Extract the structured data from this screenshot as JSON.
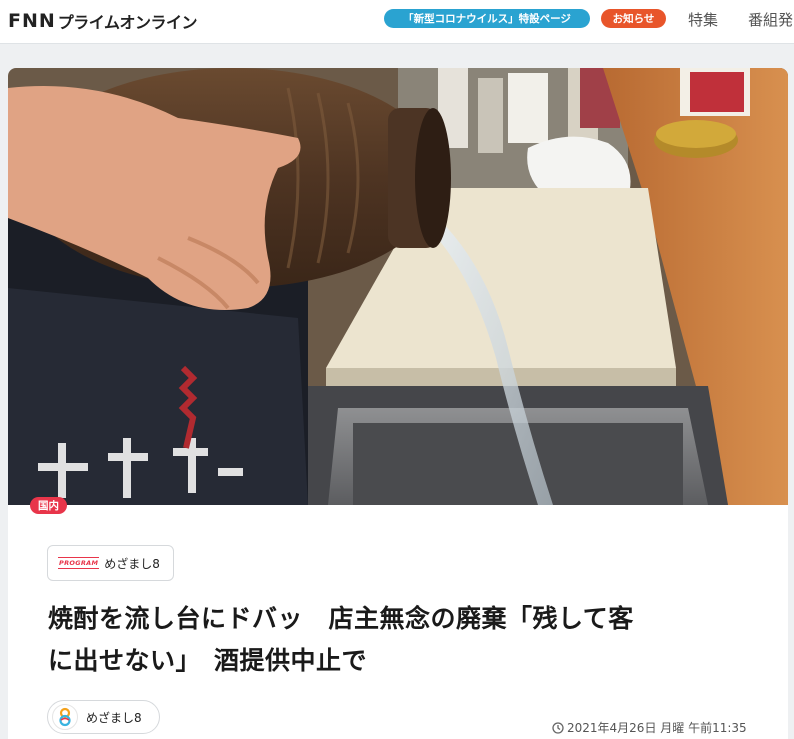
{
  "header": {
    "logo_main": "FNN",
    "logo_sub": "プライムオンライン",
    "corona_pill": "「新型コロナウイルス」特設ページ",
    "notice_pill": "お知らせ",
    "nav": [
      "特集",
      "番組発"
    ]
  },
  "article": {
    "category": "国内",
    "program_tag": "PROGRAM",
    "program_name": "めざまし8",
    "title_line1": "焼酎を流し台にドバッ　店主無念の廃棄「残して客",
    "title_line2": "に出せない」　酒提供中止で",
    "author_name": "めざまし8",
    "date": "2021年4月26日 月曜 午前11:35"
  },
  "colors": {
    "corona": "#2aa3d1",
    "notice": "#e8552a",
    "category": "#e8354a"
  },
  "icons": [
    "clock-icon",
    "avatar-logo"
  ]
}
